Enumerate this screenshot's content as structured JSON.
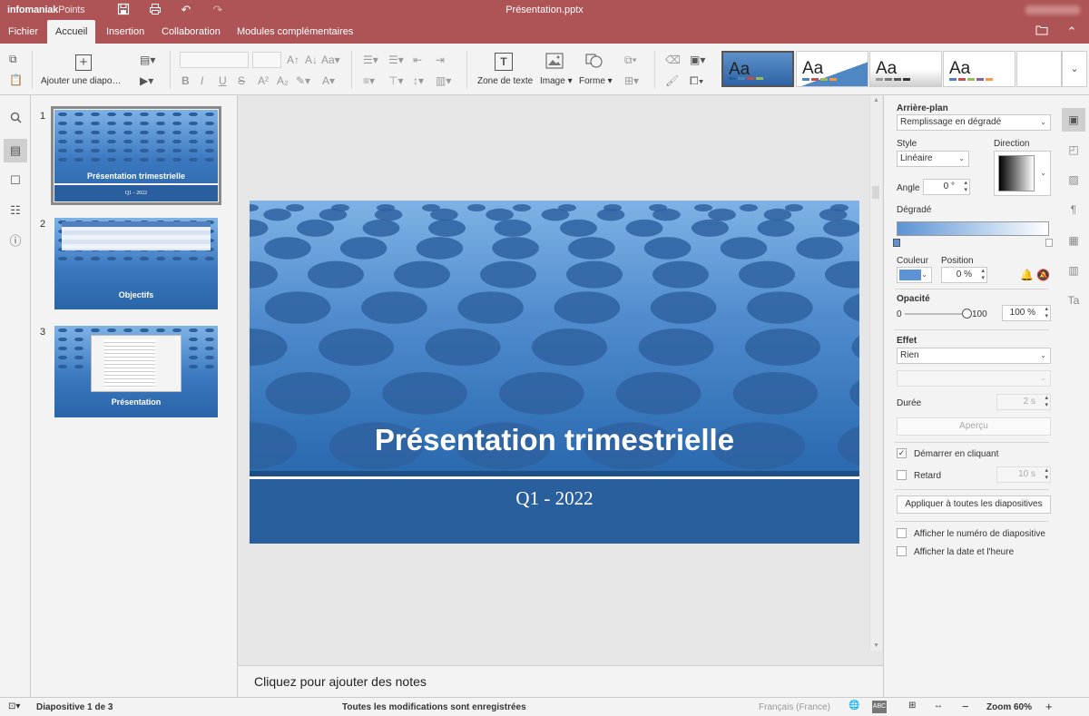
{
  "titlebar": {
    "brand_bold": "infomaniak",
    "brand_light": "Points",
    "doc_title": "Présentation.pptx"
  },
  "tabs": [
    "Fichier",
    "Accueil",
    "Insertion",
    "Collaboration",
    "Modules complémentaires"
  ],
  "active_tab": "Accueil",
  "toolbar": {
    "add_slide_label": "Ajouter une diapo…",
    "text_box_label": "Zone de texte",
    "image_label": "Image",
    "shape_label": "Forme",
    "theme_sample": "Aa"
  },
  "thumbs": [
    {
      "num": "1",
      "title": "Présentation trimestrielle",
      "sub": "Q1 - 2022"
    },
    {
      "num": "2",
      "title": "Objectifs"
    },
    {
      "num": "3",
      "title": "Présentation"
    }
  ],
  "slide": {
    "title": "Présentation trimestrielle",
    "subtitle": "Q1 - 2022"
  },
  "notes_placeholder": "Cliquez pour ajouter des notes",
  "panel": {
    "background_heading": "Arrière-plan",
    "fill_value": "Remplissage en dégradé",
    "style_label": "Style",
    "style_value": "Linéaire",
    "direction_label": "Direction",
    "angle_label": "Angle",
    "angle_value": "0 °",
    "gradient_label": "Dégradé",
    "color_label": "Couleur",
    "position_label": "Position",
    "position_value": "0 %",
    "opacity_heading": "Opacité",
    "opacity_min": "0",
    "opacity_max": "100",
    "opacity_value": "100 %",
    "effect_heading": "Effet",
    "effect_value": "Rien",
    "duration_label": "Durée",
    "duration_value": "2 s",
    "preview_label": "Aperçu",
    "start_click_label": "Démarrer en cliquant",
    "delay_label": "Retard",
    "delay_value": "10 s",
    "apply_all_label": "Appliquer à toutes les diapositives",
    "show_number_label": "Afficher le numéro de diapositive",
    "show_date_label": "Afficher la date et l'heure"
  },
  "status": {
    "slide_info": "Diapositive 1 de 3",
    "saved": "Toutes les modifications sont enregistrées",
    "language": "Français (France)",
    "zoom": "Zoom 60%"
  },
  "colors": {
    "titlebar": "#ae5456",
    "accent_blue": "#2a5f9d",
    "gradient_color": "#5b93d4"
  }
}
